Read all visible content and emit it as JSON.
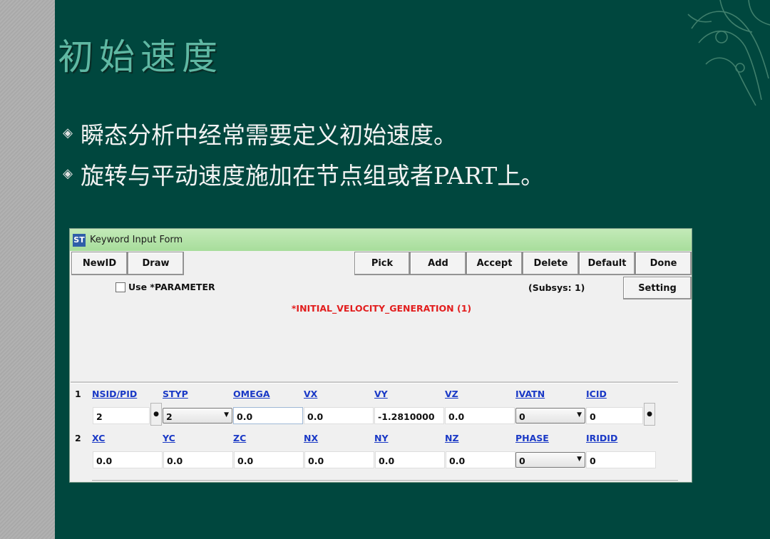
{
  "slide": {
    "title": "初始速度",
    "bullets": [
      "瞬态分析中经常需要定义初始速度。",
      "旋转与平动速度施加在节点组或者PART上。"
    ],
    "bullet_icon": "diamond-bullet-icon",
    "colors": {
      "background": "#00473e",
      "title": "#5fb8a3",
      "text": "#f2f2f2"
    }
  },
  "dialog": {
    "title": "Keyword Input Form",
    "app_icon_label": "ST",
    "buttons": {
      "newid": "NewID",
      "draw": "Draw",
      "pick": "Pick",
      "add": "Add",
      "accept": "Accept",
      "delete": "Delete",
      "default": "Default",
      "done": "Done",
      "setting": "Setting"
    },
    "use_parameter_label": "Use *PARAMETER",
    "use_parameter_checked": false,
    "subsys": "(Subsys: 1)",
    "keyword": "*INITIAL_VELOCITY_GENERATION  (1)",
    "colors": {
      "titlebar": "#b5e3a9",
      "keyword": "#e21e1e",
      "field_label": "#1a39c6"
    },
    "row1": {
      "number": "1",
      "labels": [
        "NSID/PID",
        "STYP",
        "OMEGA",
        "VX",
        "VY",
        "VZ",
        "IVATN",
        "ICID"
      ],
      "nsid": "2",
      "styp": "2",
      "omega": "0.0",
      "vx": "0.0",
      "vy": "-1.2810000",
      "vz": "0.0",
      "ivatn": "0",
      "icid": "0"
    },
    "row2": {
      "number": "2",
      "labels": [
        "XC",
        "YC",
        "ZC",
        "NX",
        "NY",
        "NZ",
        "PHASE",
        "IRIDID"
      ],
      "xc": "0.0",
      "yc": "0.0",
      "zc": "0.0",
      "nx": "0.0",
      "ny": "0.0",
      "nz": "0.0",
      "phase": "0",
      "iridid": "0"
    }
  }
}
